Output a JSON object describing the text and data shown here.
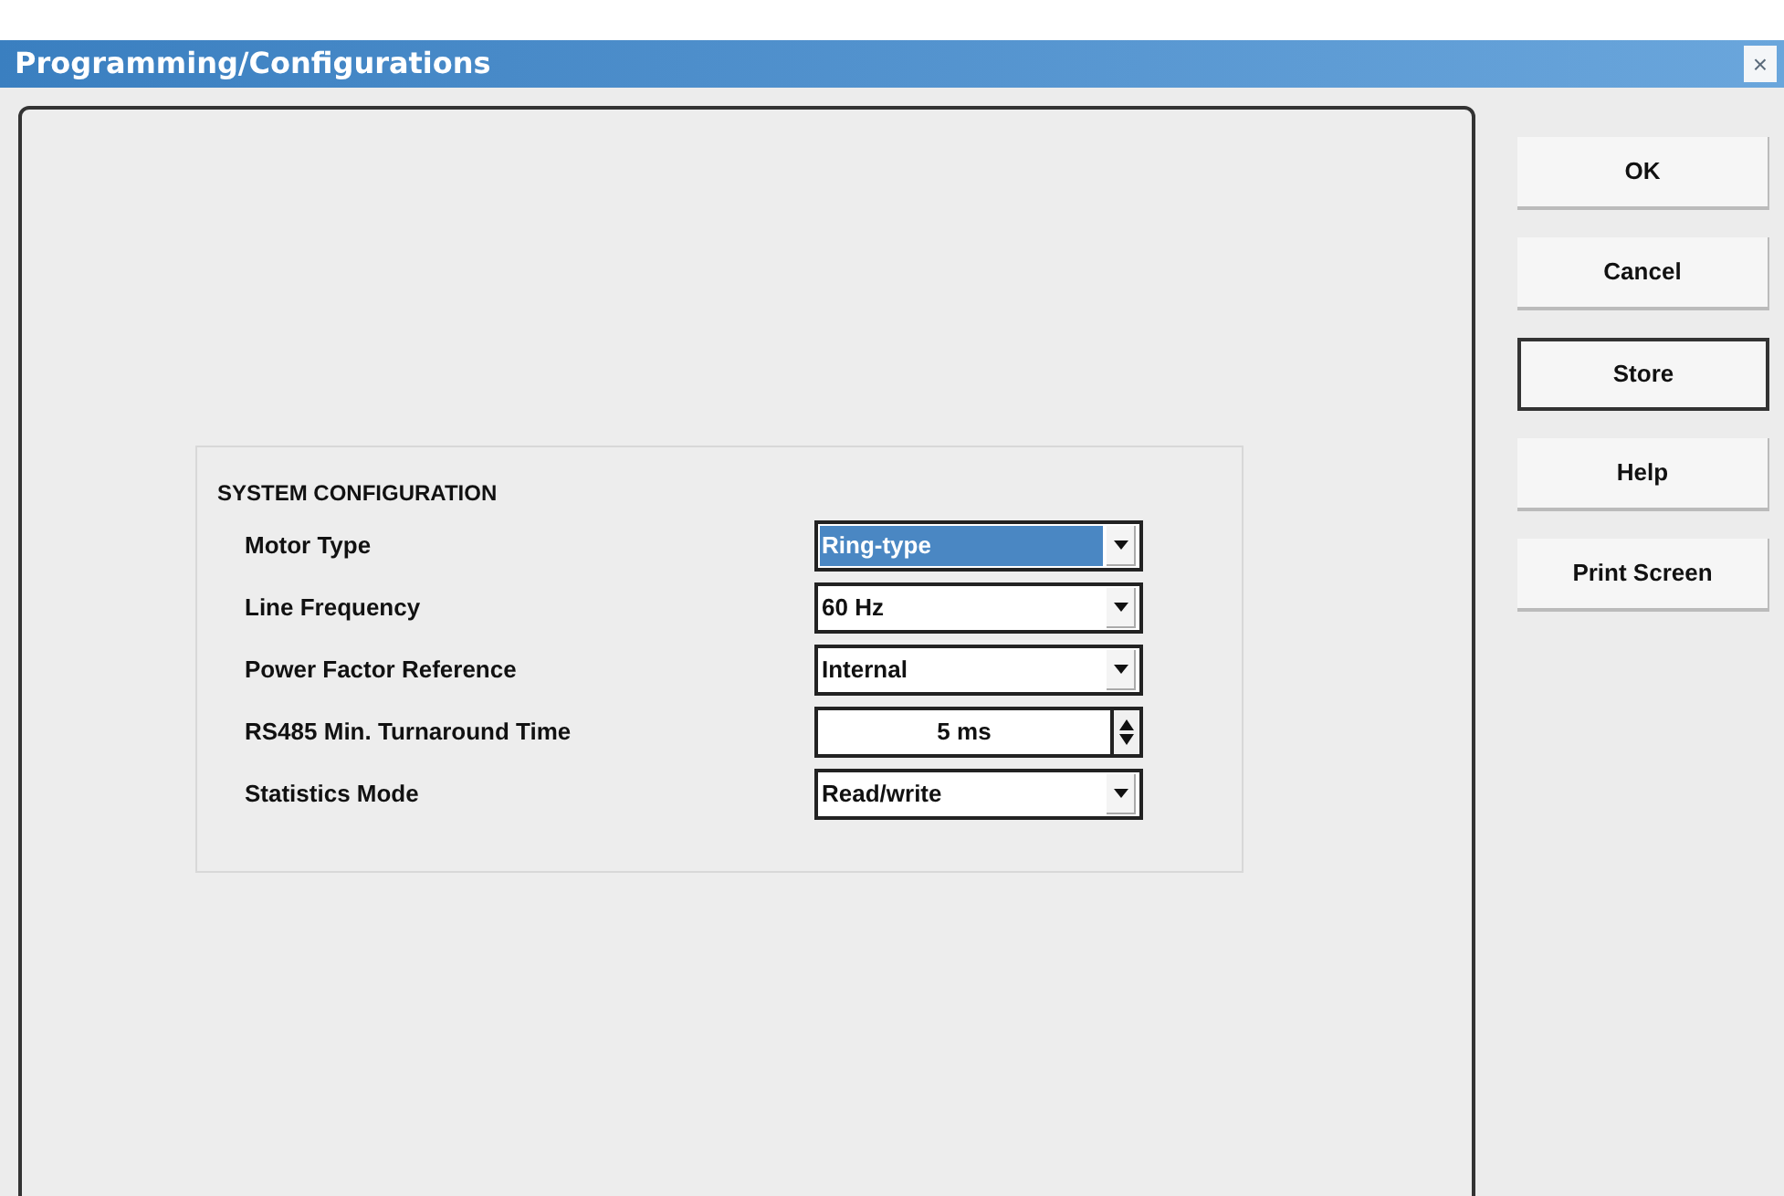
{
  "window": {
    "title": "Programming/Configurations",
    "close": "×"
  },
  "group": {
    "title": "SYSTEM CONFIGURATION",
    "rows": [
      {
        "label": "Motor Type",
        "kind": "dropdown",
        "value": "Ring-type",
        "selected": true
      },
      {
        "label": "Line Frequency",
        "kind": "dropdown",
        "value": "60 Hz",
        "selected": false
      },
      {
        "label": "Power Factor Reference",
        "kind": "dropdown",
        "value": "Internal",
        "selected": false
      },
      {
        "label": "RS485 Min. Turnaround Time",
        "kind": "spinner",
        "value": "5 ms",
        "selected": false
      },
      {
        "label": "Statistics Mode",
        "kind": "dropdown",
        "value": "Read/write",
        "selected": false
      }
    ]
  },
  "buttons": [
    {
      "label": "OK",
      "focused": false
    },
    {
      "label": "Cancel",
      "focused": false
    },
    {
      "label": "Store",
      "focused": true
    },
    {
      "label": "Help",
      "focused": false
    },
    {
      "label": "Print Screen",
      "focused": false
    }
  ]
}
